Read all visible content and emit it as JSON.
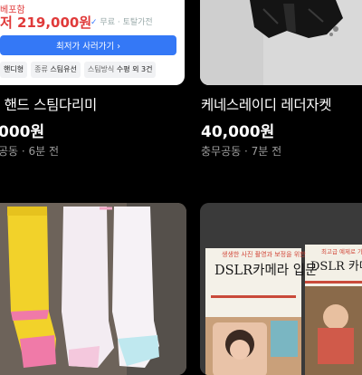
{
  "ad": {
    "tag": "베포함",
    "price": "저 219,000원",
    "shipping_check": "✓",
    "shipping": "무료 · 토탈가전",
    "cta_label": "최저가 사러가기 ›",
    "attributes": [
      {
        "key": "",
        "value": "핸디형"
      },
      {
        "key": "종류",
        "value": "스팀유선"
      },
      {
        "key": "스팀방식",
        "value": "수평 외 3건"
      }
    ]
  },
  "listings": [
    {
      "title": "' 핸드 스팀다리미",
      "price": "000원",
      "meta": "공동 · 6분 전"
    },
    {
      "title": "케네스레이디 레더자켓",
      "price": "40,000원",
      "meta": "충무공동 · 7분 전"
    }
  ],
  "books": {
    "book1_subtitle": "생생한 사진 촬영과 보정을 위한",
    "book1_title": "DSLR카메라 입문",
    "book2_subtitle": "최고급 예제로 가장 빠르게 배우는",
    "book2_title": "DSLR 카메라"
  },
  "colors": {
    "background": "#000000",
    "cta_blue": "#3478f6",
    "ad_price_red": "#e03a3a",
    "meta_gray": "#9c9c9c"
  }
}
